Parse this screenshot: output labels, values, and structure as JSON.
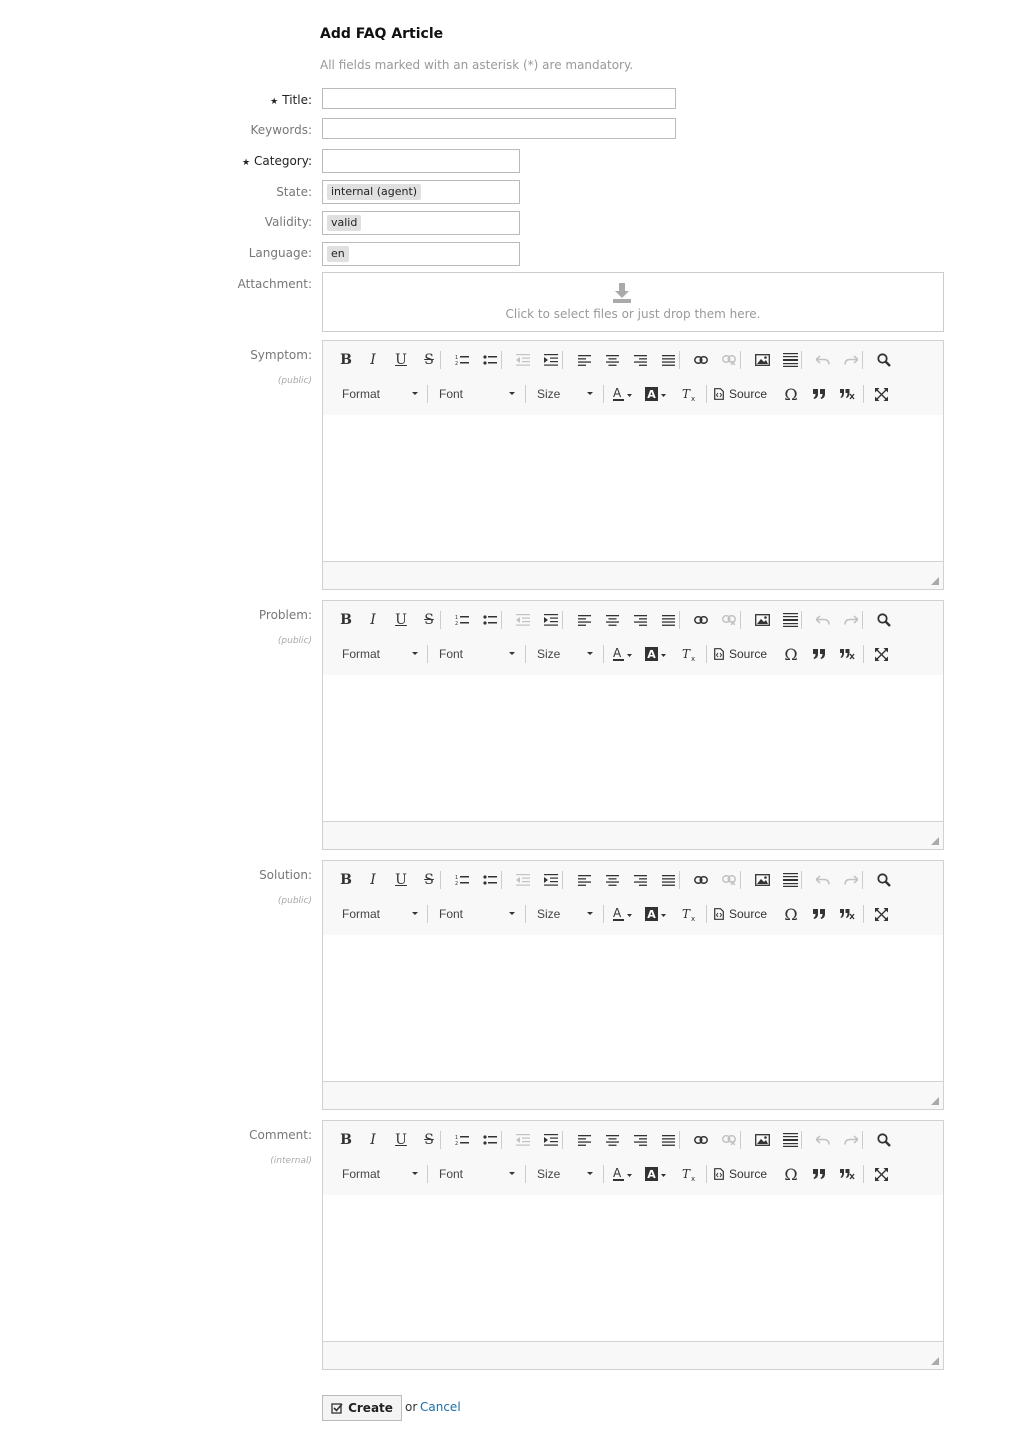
{
  "page": {
    "title": "Add FAQ Article",
    "subtitle": "All fields marked with an asterisk (*) are mandatory."
  },
  "fields": {
    "title": {
      "label": "Title:",
      "value": ""
    },
    "keywords": {
      "label": "Keywords:",
      "value": ""
    },
    "category": {
      "label": "Category:",
      "value": ""
    },
    "state": {
      "label": "State:",
      "value": "internal (agent)"
    },
    "validity": {
      "label": "Validity:",
      "value": "valid"
    },
    "language": {
      "label": "Language:",
      "value": "en"
    },
    "attachment": {
      "label": "Attachment:",
      "dropzone_text": "Click to select files or just drop them here."
    }
  },
  "editors": [
    {
      "label": "Symptom:",
      "visibility": "(public)"
    },
    {
      "label": "Problem:",
      "visibility": "(public)"
    },
    {
      "label": "Solution:",
      "visibility": "(public)"
    },
    {
      "label": "Comment:",
      "visibility": "(internal)"
    }
  ],
  "toolbar": {
    "format_label": "Format",
    "font_label": "Font",
    "size_label": "Size",
    "source_label": "Source",
    "buttons": {
      "bold": "B",
      "italic": "I",
      "underline": "U",
      "strike": "S",
      "special_char": "Ω"
    }
  },
  "actions": {
    "create_label": "Create",
    "or_text": "or",
    "cancel_label": "Cancel"
  },
  "colors": {
    "link": "#1d6fa5",
    "toolbar_bg": "#f8f8f8",
    "border": "#d1d1d1"
  }
}
